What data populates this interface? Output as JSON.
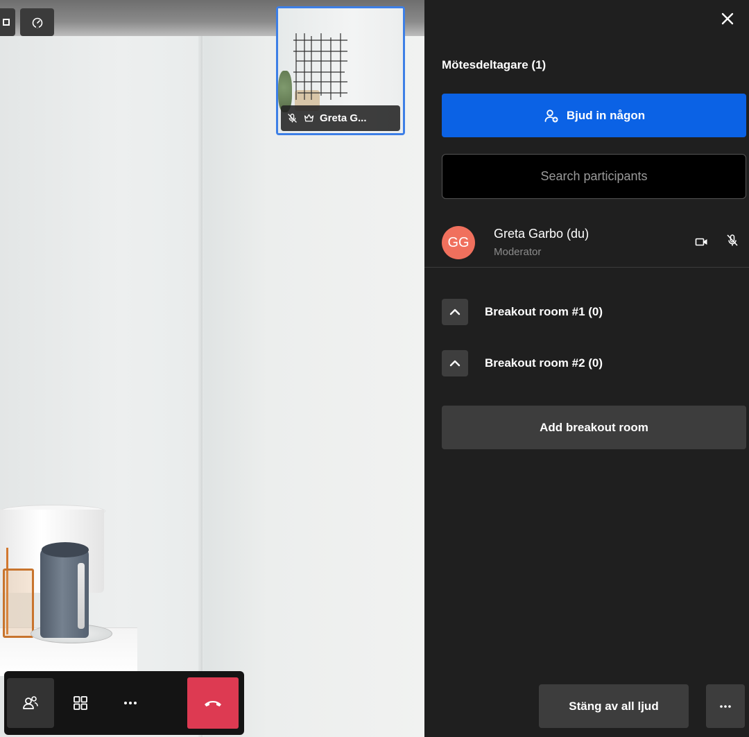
{
  "thumbnail": {
    "participant_name": "Greta G..."
  },
  "panel": {
    "title": "Mötesdeltagare (1)",
    "invite_label": "Bjud in någon",
    "search_placeholder": "Search participants",
    "participant": {
      "initials": "GG",
      "name": "Greta Garbo (du)",
      "role": "Moderator",
      "avatar_color": "#f0705d"
    },
    "breakout_rooms": [
      {
        "label": "Breakout room #1 (0)"
      },
      {
        "label": "Breakout room #2 (0)"
      }
    ],
    "add_room_label": "Add breakout room",
    "mute_all_label": "Stäng av all ljud"
  },
  "colors": {
    "accent": "#0b62e5",
    "thumbnail_border": "#3d7fe6",
    "hangup": "#dd3a52",
    "panel_bg": "#1f1f1f"
  },
  "icons": {
    "stage": [
      "tile-view-icon",
      "speedometer-icon"
    ],
    "toolbar": [
      "participants-icon",
      "grid-icon",
      "more-icon",
      "hangup-icon"
    ],
    "thumbnail": [
      "mic-muted-icon",
      "crown-icon"
    ],
    "panel": [
      "close-icon",
      "add-user-icon",
      "camera-icon",
      "mic-muted-icon",
      "chevron-up-icon",
      "more-icon"
    ]
  }
}
